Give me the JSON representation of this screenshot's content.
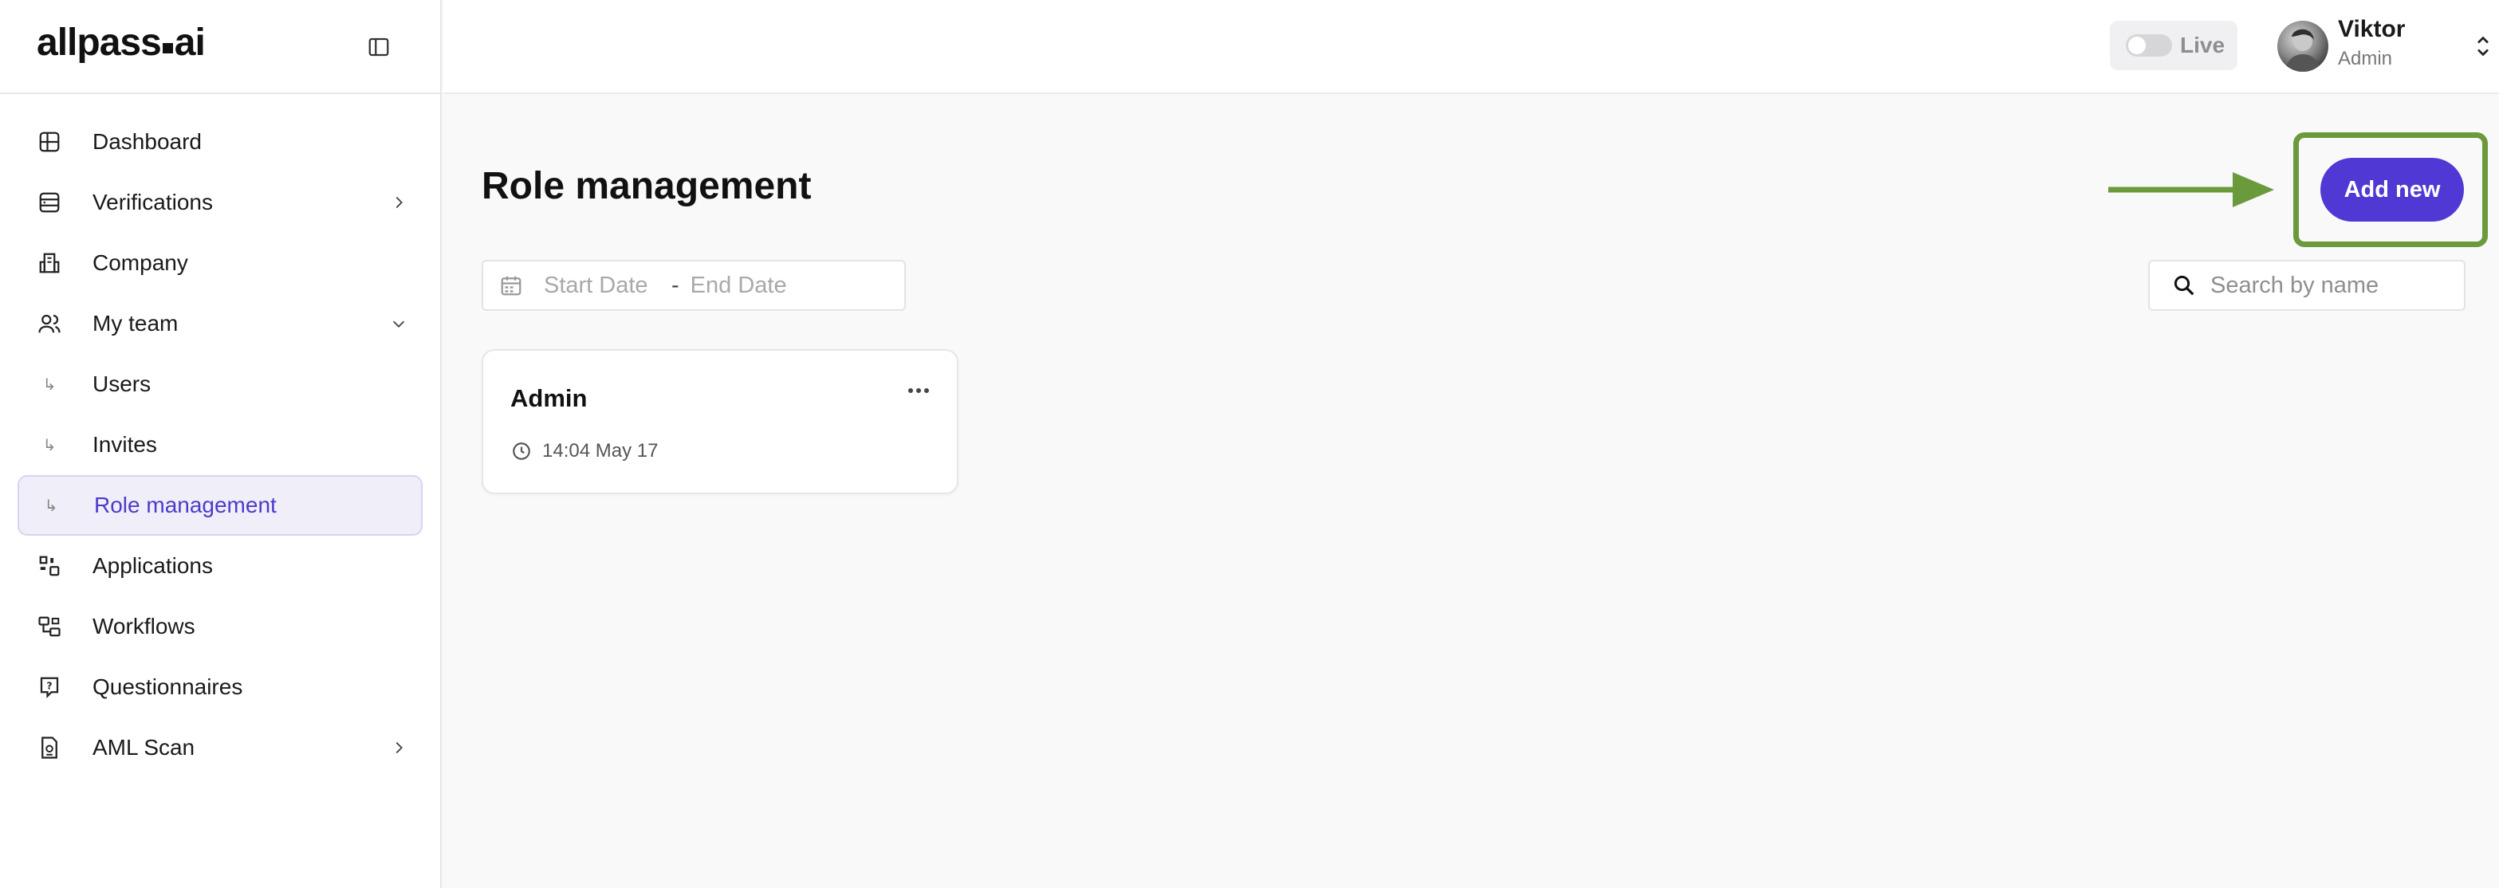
{
  "brand": {
    "logo_part1": "allpass",
    "logo_part2": "ai"
  },
  "sidebar": {
    "items": [
      {
        "label": "Dashboard",
        "icon": "dashboard-grid-icon"
      },
      {
        "label": "Verifications",
        "icon": "database-icon",
        "chevron": "right"
      },
      {
        "label": "Company",
        "icon": "building-icon"
      },
      {
        "label": "My team",
        "icon": "users-icon",
        "chevron": "down"
      },
      {
        "label": "Users",
        "icon": "sub-arrow-icon",
        "sub": true
      },
      {
        "label": "Invites",
        "icon": "sub-arrow-icon",
        "sub": true
      },
      {
        "label": "Role management",
        "icon": "sub-arrow-icon",
        "sub": true,
        "active": true
      },
      {
        "label": "Applications",
        "icon": "apps-icon"
      },
      {
        "label": "Workflows",
        "icon": "workflow-icon"
      },
      {
        "label": "Questionnaires",
        "icon": "question-icon"
      },
      {
        "label": "AML Scan",
        "icon": "document-scan-icon",
        "chevron": "right"
      }
    ]
  },
  "topbar": {
    "live_label": "Live",
    "live_enabled": false,
    "user_name": "Viktor",
    "user_role": "Admin"
  },
  "main": {
    "title": "Role management",
    "start_date_placeholder": "Start Date",
    "date_separator": "-",
    "end_date_placeholder": "End Date",
    "search_placeholder": "Search by name",
    "add_button_label": "Add new",
    "roles": [
      {
        "name": "Admin",
        "timestamp": "14:04 May 17"
      }
    ]
  },
  "colors": {
    "accent": "#5038d4",
    "active_bg": "#f0eef9",
    "highlight": "#6a9a3c"
  }
}
